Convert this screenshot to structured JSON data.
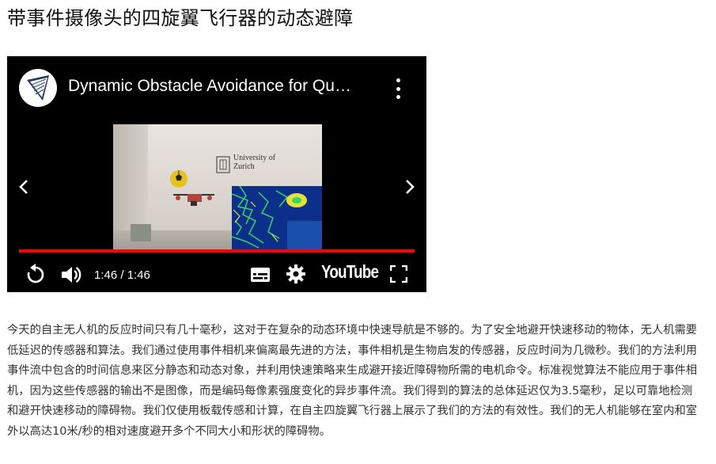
{
  "page": {
    "title": "带事件摄像头的四旋翼飞行器的动态避障"
  },
  "video": {
    "title": "Dynamic Obstacle Avoidance for Qu…",
    "time": "1:46 / 1:46",
    "progress_fraction": 1.0,
    "progress_color": "#ff0000",
    "brand": "YouTube",
    "frame_sign": {
      "line1": "University of",
      "line2": "Zurich"
    }
  },
  "icons": {
    "channel_logo": "channel-logo-icon",
    "more": "more-vertical-icon",
    "prev": "chevron-left-icon",
    "next": "chevron-right-icon",
    "replay": "replay-icon",
    "volume": "volume-icon",
    "captions": "captions-icon",
    "settings": "gear-icon",
    "fullscreen": "fullscreen-icon"
  },
  "article": {
    "body": "今天的自主无人机的反应时间只有几十毫秒，这对于在复杂的动态环境中快速导航是不够的。为了安全地避开快速移动的物体，无人机需要低延迟的传感器和算法。我们通过使用事件相机来偏离最先进的方法，事件相机是生物启发的传感器，反应时间为几微秒。我们的方法利用事件流中包含的时间信息来区分静态和动态对象，并利用快速策略来生成避开接近障碍物所需的电机命令。标准视觉算法不能应用于事件相机，因为这些传感器的输出不是图像，而是编码每像素强度变化的异步事件流。我们得到的算法的总体延迟仅为3.5毫秒，足以可靠地检测和避开快速移动的障碍物。我们仅使用板载传感和计算，在自主四旋翼飞行器上展示了我们的方法的有效性。我们的无人机能够在室内和室外以高达10米/秒的相对速度避开多个不同大小和形状的障碍物。"
  }
}
